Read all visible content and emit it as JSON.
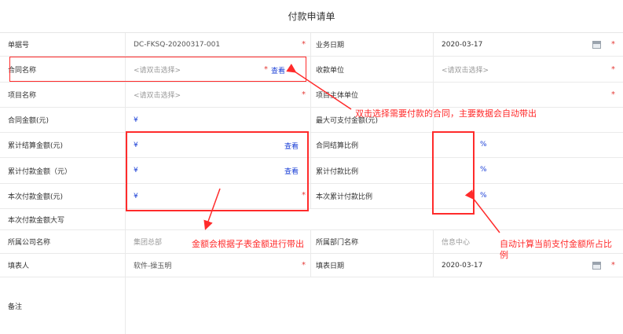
{
  "form": {
    "title": "付款申请单"
  },
  "rows": {
    "doc_no": {
      "label": "单据号",
      "value": "DC-FKSQ-20200317-001",
      "label2": "业务日期",
      "value2": "2020-03-17"
    },
    "contract": {
      "label": "合同名称",
      "placeholder": "<请双击选择>",
      "view": "查看",
      "label2": "收款单位",
      "placeholder2": "<请双击选择>"
    },
    "project": {
      "label": "项目名称",
      "placeholder": "<请双击选择>",
      "label2": "项目主体单位"
    },
    "amount": {
      "label": "合同金额(元)",
      "currency": "¥",
      "label2": "最大可支付金额(元)"
    },
    "settled": {
      "label": "累计结算金额(元)",
      "currency": "¥",
      "view": "查看",
      "label2": "合同结算比例",
      "percent": "%"
    },
    "paid": {
      "label": "累计付款金额（元）",
      "currency": "¥",
      "view": "查看",
      "label2": "累计付款比例",
      "percent": "%"
    },
    "current": {
      "label": "本次付款金额(元)",
      "currency": "¥",
      "label2": "本次累计付款比例",
      "percent": "%"
    },
    "upper": {
      "label": "本次付款金额大写"
    },
    "company": {
      "label": "所属公司名称",
      "value": "集团总部",
      "label2": "所属部门名称",
      "value2": "信息中心"
    },
    "filler": {
      "label": "填表人",
      "value": "软件-操玉明",
      "label2": "填表日期",
      "value2": "2020-03-17"
    },
    "remark": {
      "label": "备注"
    }
  },
  "required_mark": "*",
  "annotations": {
    "contract_note": "双击选择需要付款的合同，主要数据会自动带出",
    "amount_note": "金额会根据子表金额进行带出",
    "ratio_note_line1": "自动计算当前支付金额所占比",
    "ratio_note_line2": "例"
  },
  "colors": {
    "required": "#e53935",
    "link": "#1a3fd6",
    "annotation": "#ff2b2b"
  }
}
